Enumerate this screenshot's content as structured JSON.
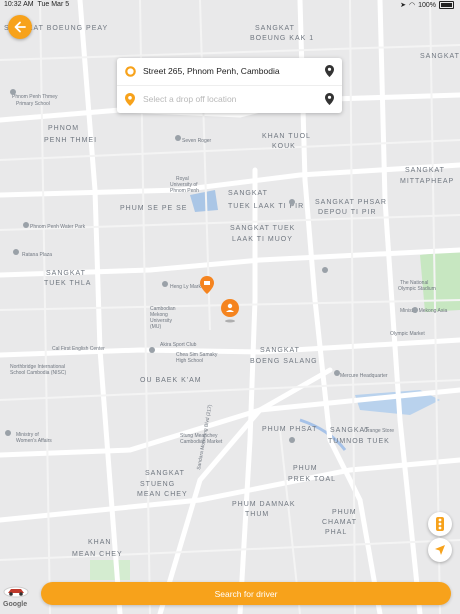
{
  "status_bar": {
    "time": "10:32 AM",
    "date": "Tue Mar 5",
    "battery": "100%"
  },
  "pickup": {
    "value": "Street 265, Phnom Penh, Cambodia"
  },
  "dropoff": {
    "placeholder": "Select a drop off location"
  },
  "search_button": {
    "label": "Search for driver"
  },
  "map_labels": {
    "districts": [
      "SANGKAT BOEUNG KAK 1",
      "PHNOM PENH THMEI",
      "KHAN TUOL KOUK",
      "SANGKAT MITTAPHEAP",
      "PHUM SE PE SE",
      "SANGKAT TUEK LAAK TI PIR",
      "SANGKAT PHSAR DEPOU TI PIR",
      "SANGKAT TUEK LAAK TI MUOY",
      "SANGKAT TUEK THLA",
      "SANGKAT BOENG SALANG",
      "OU BAEK K'AM",
      "PHUM PHSAT",
      "SANGKAT TUMNOB TUEK",
      "PHUM PREK TOAL",
      "SANGKAT STUENG MEAN CHEY",
      "PHUM DAMNAK THUM",
      "PHUM CHAMAT PHAL",
      "KHAN MEAN CHEY",
      "SANGKAT BOEUNG PEAY"
    ],
    "places": [
      "Phnom Penh Thmey Primary School",
      "Seven Roger",
      "Royal University of Phnom Penh",
      "Phnom Penh Water Park",
      "Ratana Plaza",
      "Heng Ly Market",
      "Cambodian Mekong University (MU)",
      "Cal First English Center",
      "Akira Sport Club",
      "Chea Sim Samaky High School",
      "Northbridge International School Cambodia (NISC)",
      "Stung Meanchey Cambodian Market",
      "Ministry of Women's Affairs",
      "Orange Store",
      "The National Olympic Stadium",
      "Olympic Market",
      "Mercure Headquarter",
      "Ministry Mekong Asia"
    ],
    "roads": [
      "Sandara Monivong Blvd (217)"
    ]
  },
  "colors": {
    "accent": "#f7a21b",
    "map_bg": "#e9e9ea",
    "road": "#ffffff",
    "park": "#c7e7c1"
  },
  "icons": {
    "back": "arrow-left-icon",
    "pickup": "ring-dot-icon",
    "dropoff": "location-pin-icon",
    "map_pin": "map-marker-icon",
    "traffic": "traffic-light-icon",
    "locate": "navigation-arrow-icon"
  }
}
